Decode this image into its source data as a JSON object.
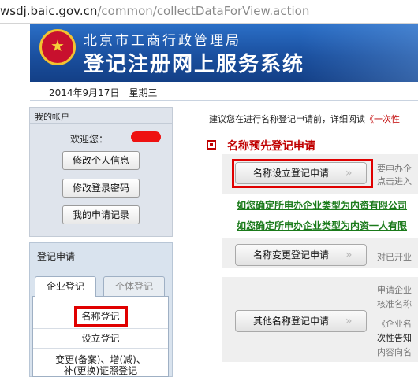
{
  "browser": {
    "url_domain": "wsdj.baic.gov.cn",
    "url_path": "/common/collectDataForView.action"
  },
  "banner": {
    "org_name": "北京市工商行政管理局",
    "system_name": "登记注册网上服务系统",
    "emblem_icon": "national-emblem-icon"
  },
  "date_line": "2014年9月17日　星期三",
  "account": {
    "title": "我的帐户",
    "welcome": "欢迎您：",
    "buttons": [
      "修改个人信息",
      "修改登录密码",
      "我的申请记录"
    ]
  },
  "apply": {
    "title": "登记申请",
    "tabs": [
      "企业登记",
      "个体登记"
    ],
    "menu": [
      "名称登记",
      "设立登记",
      "变更(备案)、增(减)、",
      "补(更换)证照登记"
    ]
  },
  "main": {
    "intro_text": "建议您在进行名称登记申请前，详细阅读",
    "intro_link": "《一次性",
    "section_title": "名称预先登记申请",
    "btn_setup": "名称设立登记申请",
    "setup_desc_1": "要申办企",
    "setup_desc_2": "点击进入",
    "link_1": "如您确定所申办企业类型为内资有限公司",
    "link_2": "如您确定所申办企业类型为内资一人有限",
    "btn_change": "名称变更登记申请",
    "change_desc": "对已开业",
    "btn_other": "其他名称登记申请",
    "other_desc": [
      "申请企业",
      "核准名称",
      "《企业名",
      "次性告知",
      "内容向名"
    ]
  },
  "colors": {
    "accent_red": "#c00000",
    "banner_blue": "#1a56a8",
    "link_green": "#1a7a1a",
    "highlight_red": "#e00000"
  }
}
